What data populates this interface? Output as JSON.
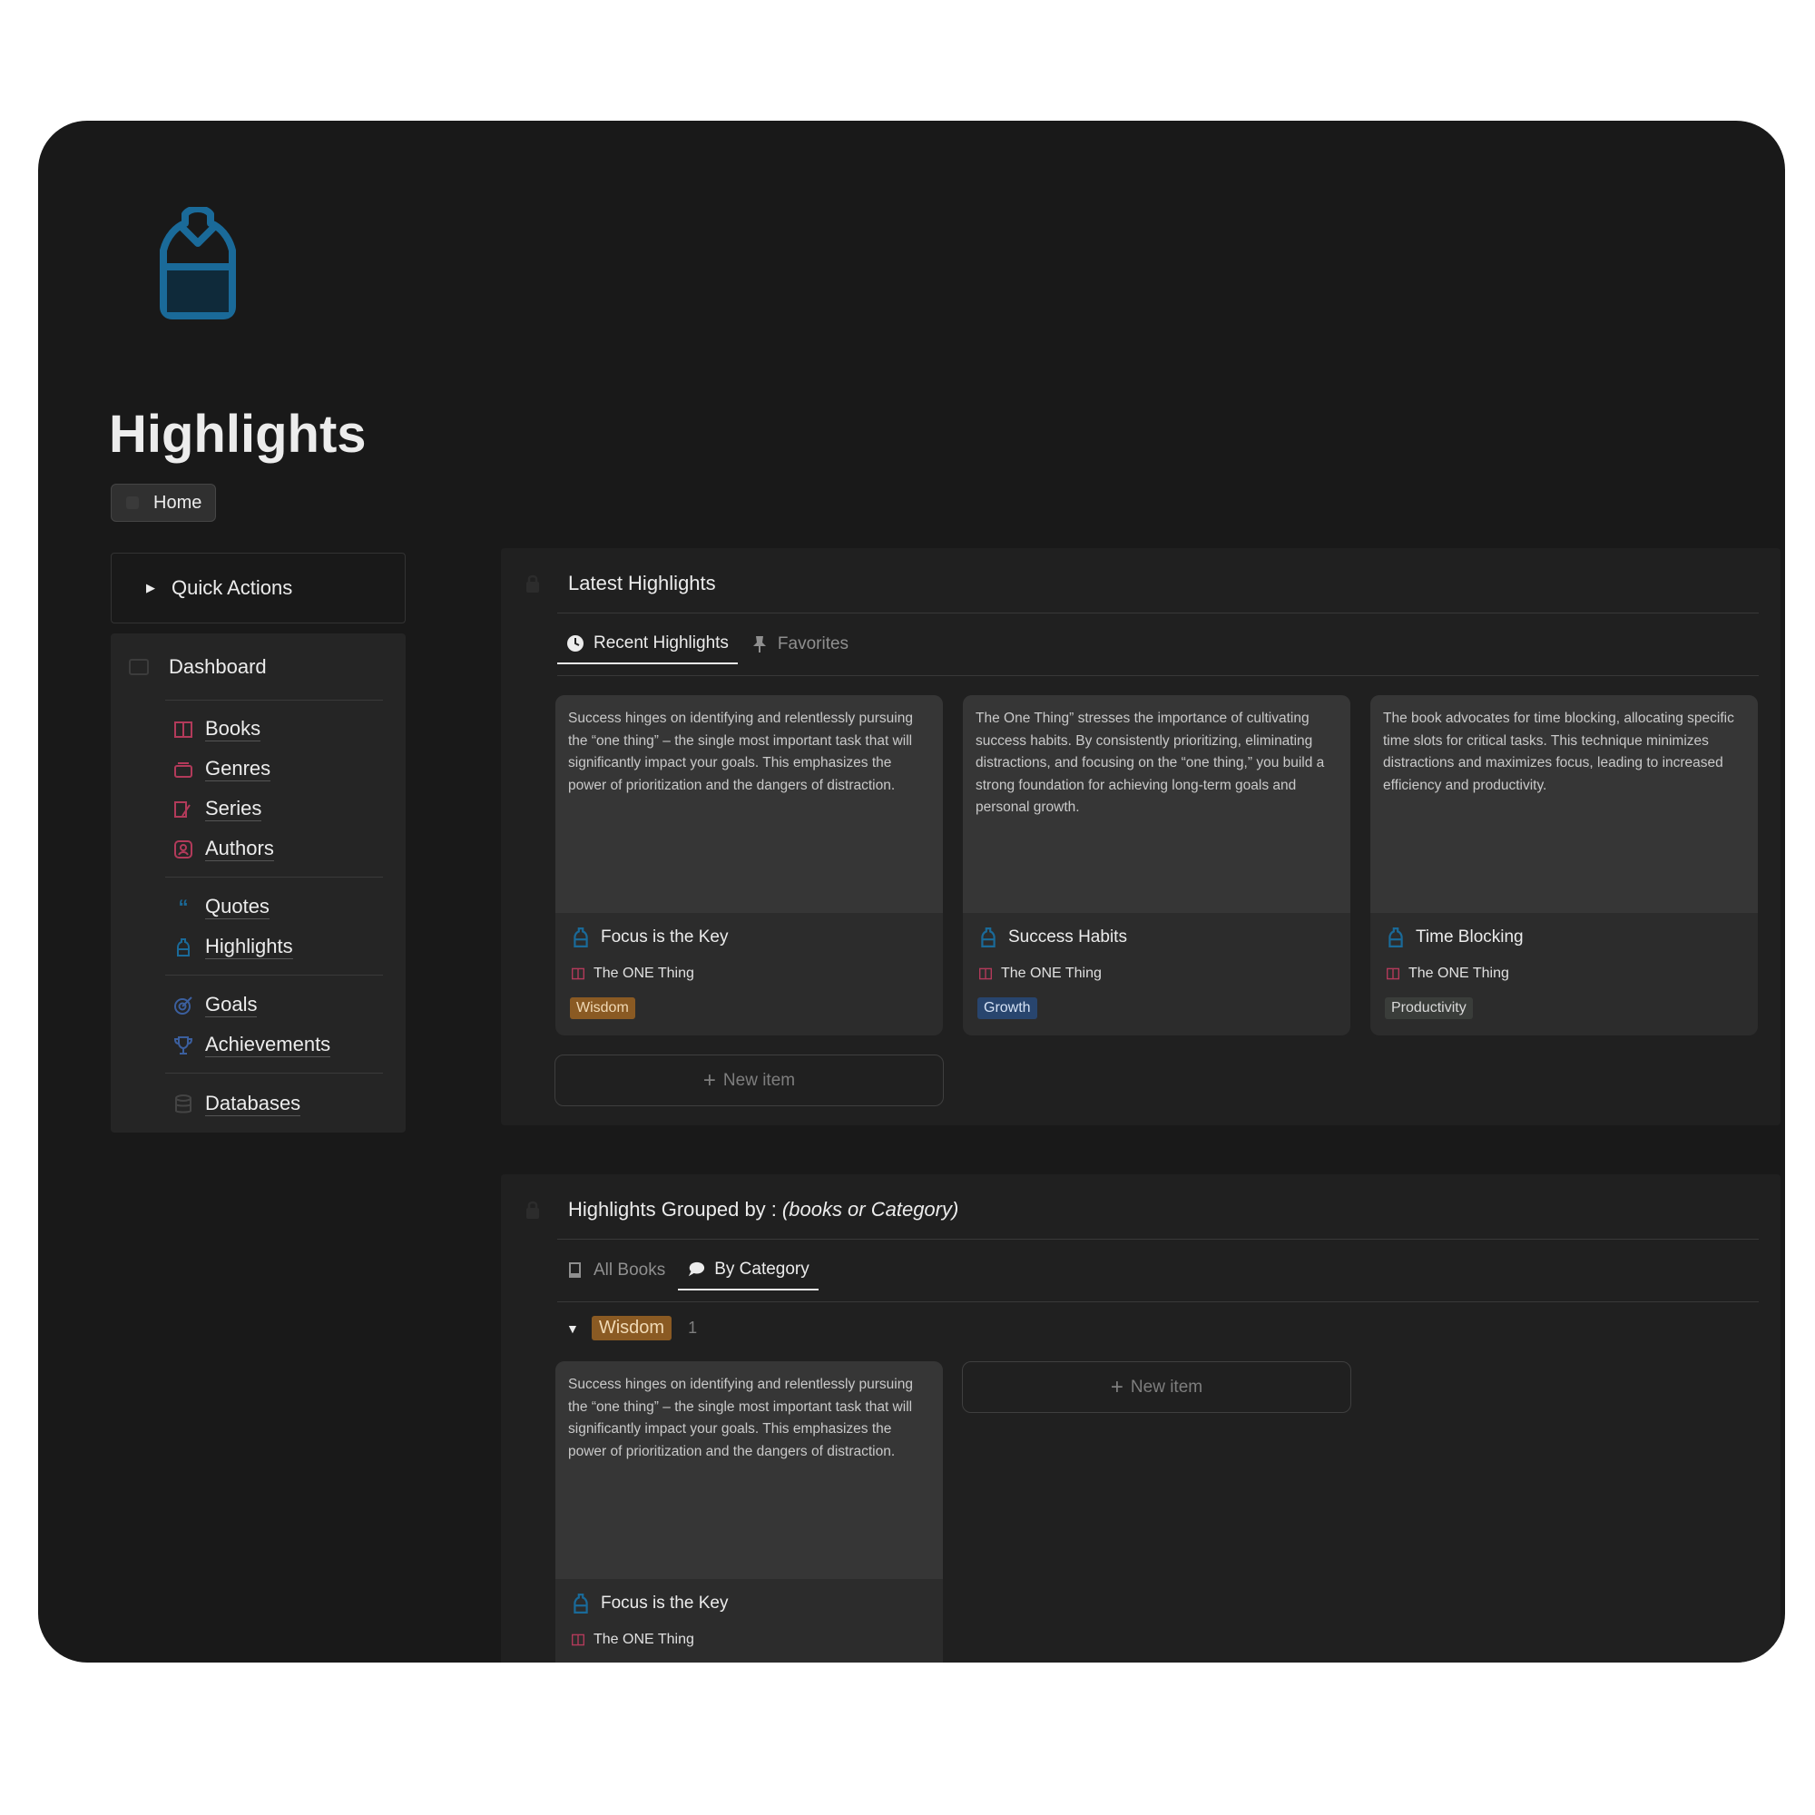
{
  "page": {
    "title": "Highlights",
    "home_label": "Home"
  },
  "quick_actions": {
    "label": "Quick Actions"
  },
  "sidebar": {
    "dashboard": "Dashboard",
    "items": [
      {
        "label": "Books",
        "icon": "book-icon"
      },
      {
        "label": "Genres",
        "icon": "genre-icon"
      },
      {
        "label": "Series",
        "icon": "series-icon"
      },
      {
        "label": "Authors",
        "icon": "author-icon"
      },
      {
        "label": "Quotes",
        "icon": "quote-icon"
      },
      {
        "label": "Highlights",
        "icon": "highlighter-icon"
      },
      {
        "label": "Goals",
        "icon": "target-icon"
      },
      {
        "label": "Achievements",
        "icon": "trophy-icon"
      },
      {
        "label": "Databases",
        "icon": "database-icon"
      }
    ]
  },
  "latest": {
    "title": "Latest Highlights",
    "tabs": [
      {
        "label": "Recent Highlights"
      },
      {
        "label": "Favorites"
      }
    ],
    "cards": [
      {
        "text": "Success hinges on identifying and relentlessly pursuing the “one thing” – the single most important task that will significantly impact your goals. This emphasizes the power of prioritization and the dangers of distraction.",
        "title": "Focus is the Key",
        "book": "The ONE Thing",
        "tag": "Wisdom"
      },
      {
        "text": "The One Thing” stresses the importance of cultivating success habits. By consistently prioritizing, eliminating distractions, and focusing on the “one thing,” you build a strong foundation for achieving long-term goals and personal growth.",
        "title": "Success Habits",
        "book": "The ONE Thing",
        "tag": "Growth"
      },
      {
        "text": "The book advocates for time blocking, allocating specific time slots for critical tasks. This technique minimizes distractions and maximizes focus, leading to increased efficiency and productivity.",
        "title": "Time Blocking",
        "book": "The ONE Thing",
        "tag": "Productivity"
      }
    ],
    "new_item": "New item"
  },
  "grouped": {
    "title": "Highlights Grouped by :",
    "title_suffix": "(books or Category)",
    "tabs": [
      {
        "label": "All Books"
      },
      {
        "label": "By Category"
      }
    ],
    "group": {
      "name": "Wisdom",
      "count": "1"
    },
    "card": {
      "text": "Success hinges on identifying and relentlessly pursuing the “one thing” – the single most important task that will significantly impact your goals. This emphasizes the power of prioritization and the dangers of distraction.",
      "title": "Focus is the Key",
      "book": "The ONE Thing"
    },
    "new_item": "New item"
  },
  "colors": {
    "accent_blue": "#1a6a99",
    "book_red": "#b23a5a",
    "tag_wisdom": "#8a5a23",
    "tag_growth": "#28456e",
    "tag_productivity": "#3a3d3a"
  }
}
